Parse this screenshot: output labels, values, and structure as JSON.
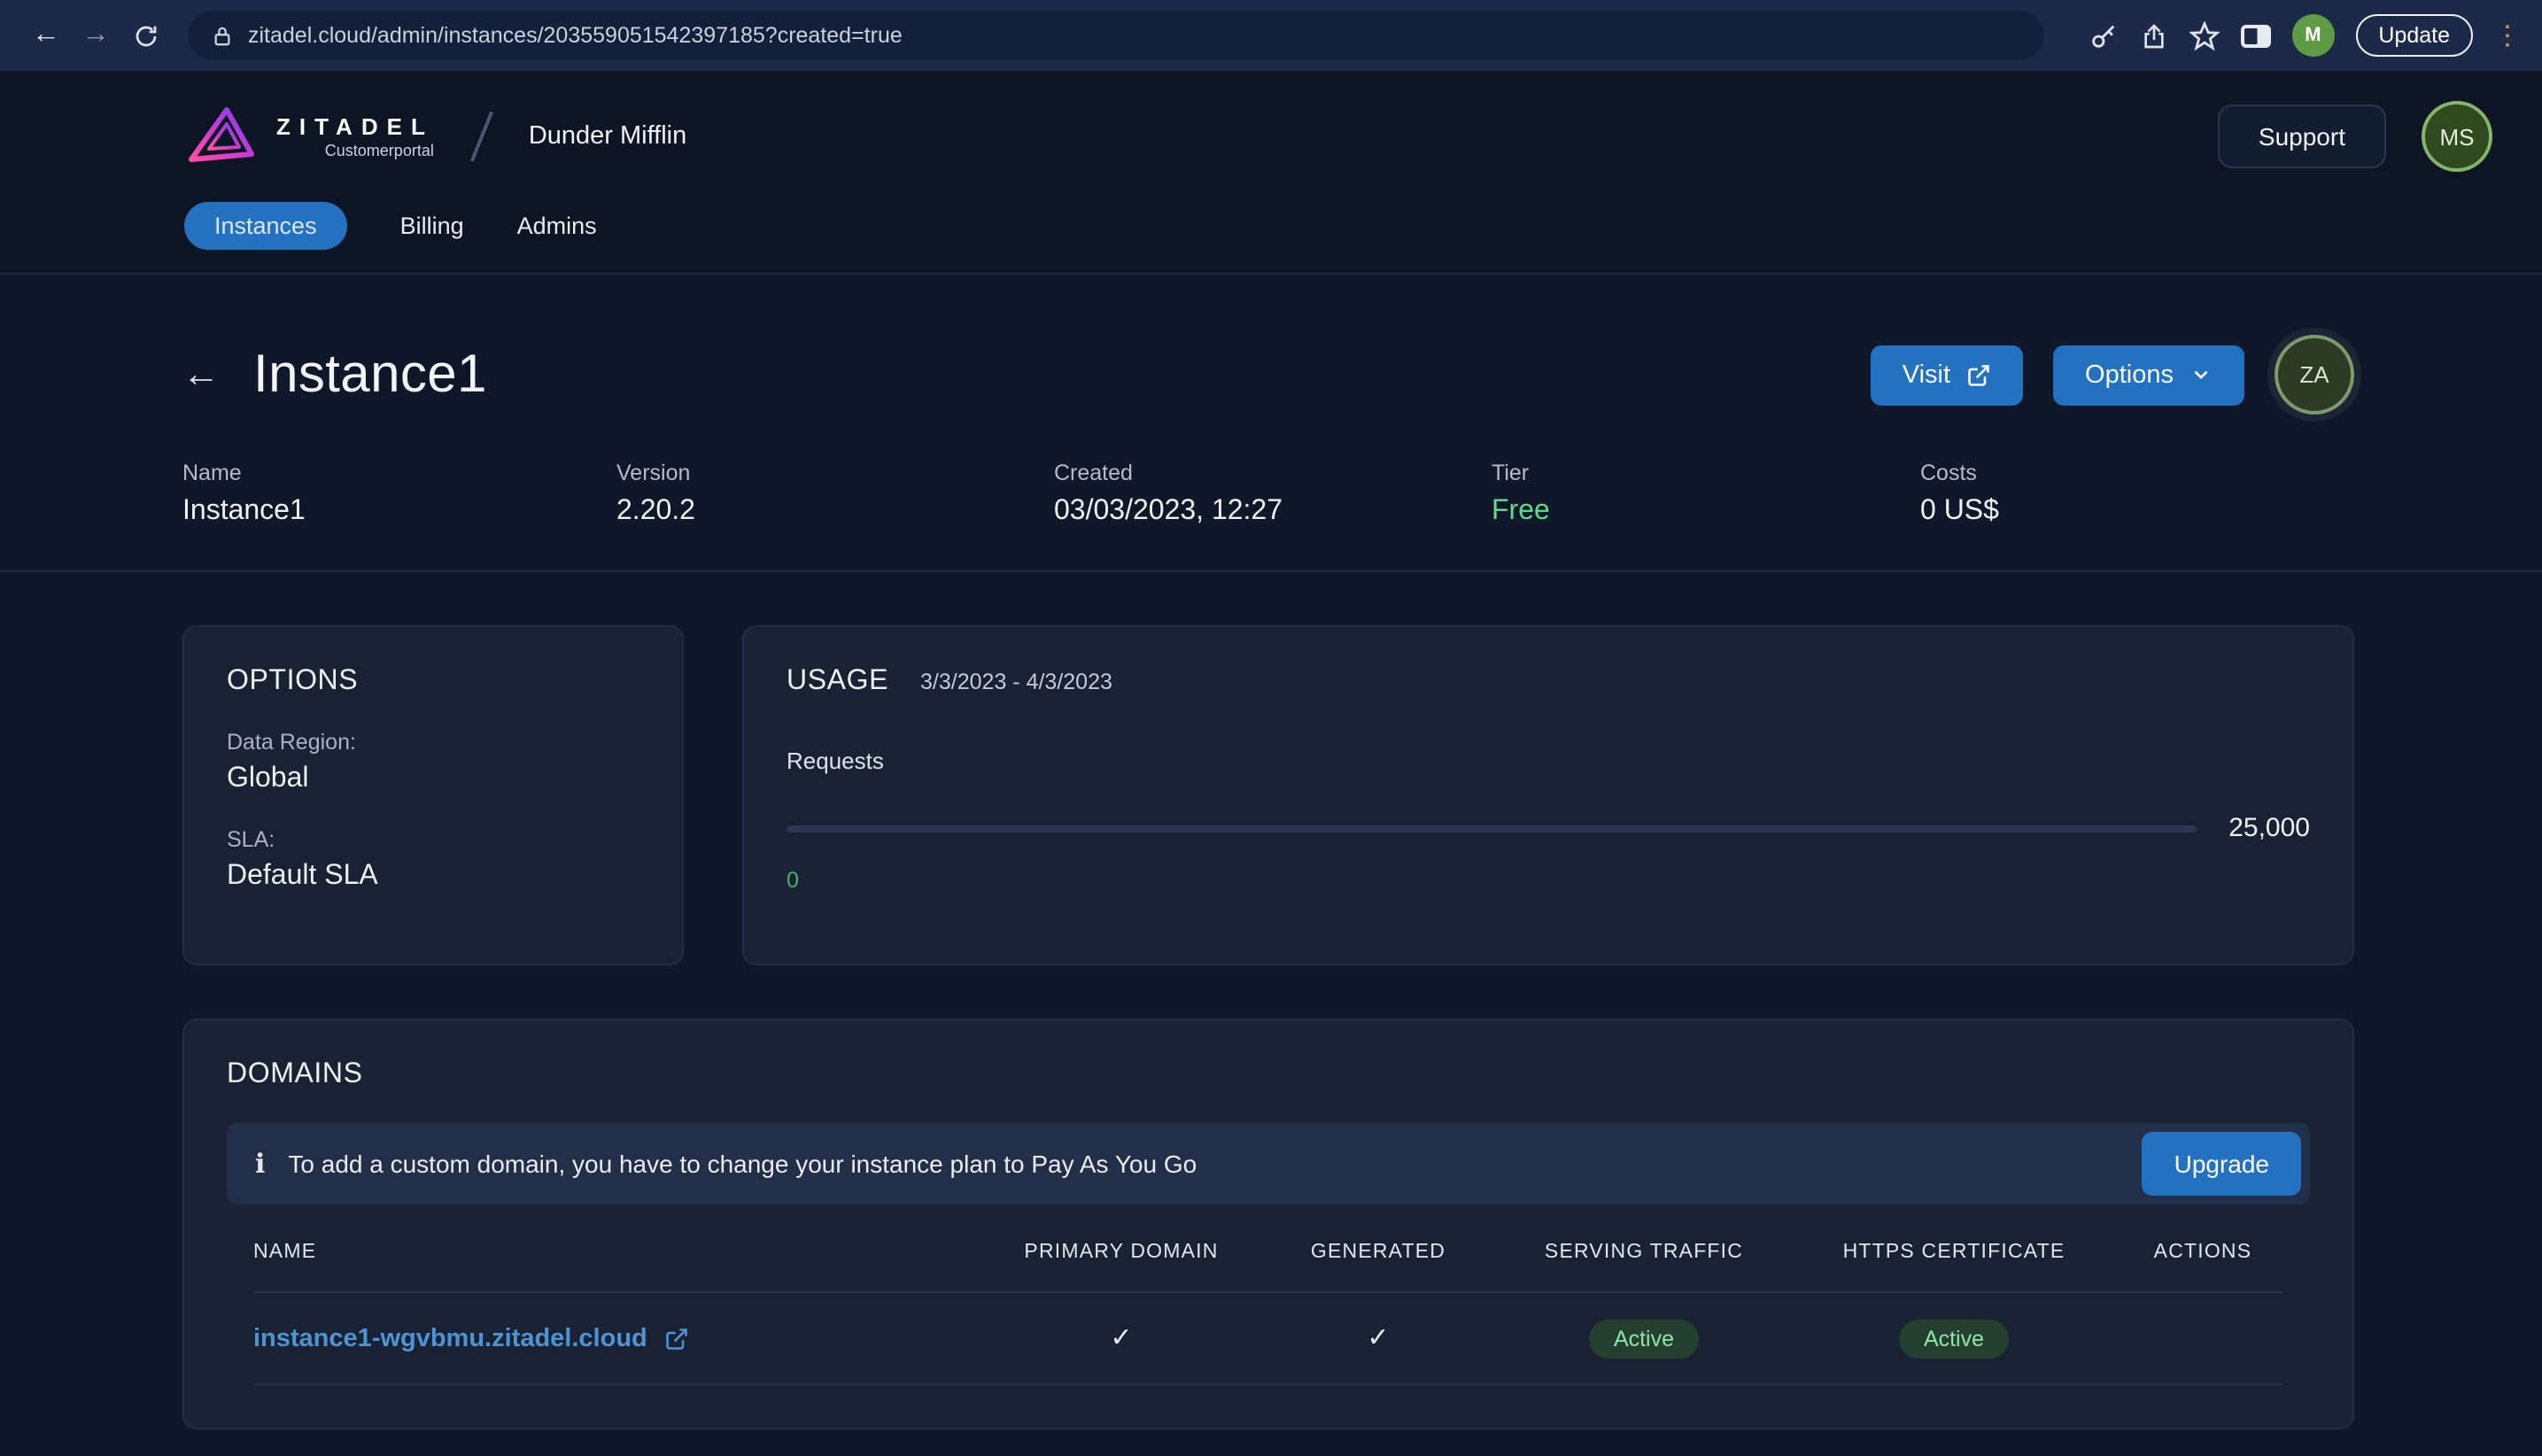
{
  "browser": {
    "url": "zitadel.cloud/admin/instances/203559051542397185?created=true",
    "update_label": "Update",
    "avatar_initial": "M"
  },
  "header": {
    "brand": "ZITADEL",
    "brand_sub": "Customerportal",
    "org": "Dunder Mifflin",
    "support_label": "Support",
    "avatar_initials": "MS",
    "tabs": [
      {
        "label": "Instances"
      },
      {
        "label": "Billing"
      },
      {
        "label": "Admins"
      }
    ]
  },
  "page": {
    "title": "Instance1",
    "visit_label": "Visit",
    "options_label": "Options",
    "avatar_initials": "ZA",
    "meta": [
      {
        "label": "Name",
        "value": "Instance1"
      },
      {
        "label": "Version",
        "value": "2.20.2"
      },
      {
        "label": "Created",
        "value": "03/03/2023, 12:27"
      },
      {
        "label": "Tier",
        "value": "Free"
      },
      {
        "label": "Costs",
        "value": "0 US$"
      }
    ]
  },
  "options_card": {
    "title": "OPTIONS",
    "fields": [
      {
        "label": "Data Region:",
        "value": "Global"
      },
      {
        "label": "SLA:",
        "value": "Default SLA"
      }
    ]
  },
  "usage_card": {
    "title": "USAGE",
    "period": "3/3/2023 - 4/3/2023",
    "metric_label": "Requests",
    "max_value": "25,000",
    "current_value": "0"
  },
  "domains_card": {
    "title": "DOMAINS",
    "banner_text": "To add a custom domain, you have to change your instance plan to Pay As You Go",
    "upgrade_label": "Upgrade",
    "columns": [
      "NAME",
      "PRIMARY DOMAIN",
      "GENERATED",
      "SERVING TRAFFIC",
      "HTTPS CERTIFICATE",
      "ACTIONS"
    ],
    "rows": [
      {
        "name": "instance1-wgvbmu.zitadel.cloud",
        "primary_domain": "yes",
        "generated": "yes",
        "serving_status": "Active",
        "https_status": "Active"
      }
    ]
  },
  "colors": {
    "accent_blue": "#2372c1",
    "success_green": "#66d68d",
    "link_blue": "#4d95d2"
  }
}
